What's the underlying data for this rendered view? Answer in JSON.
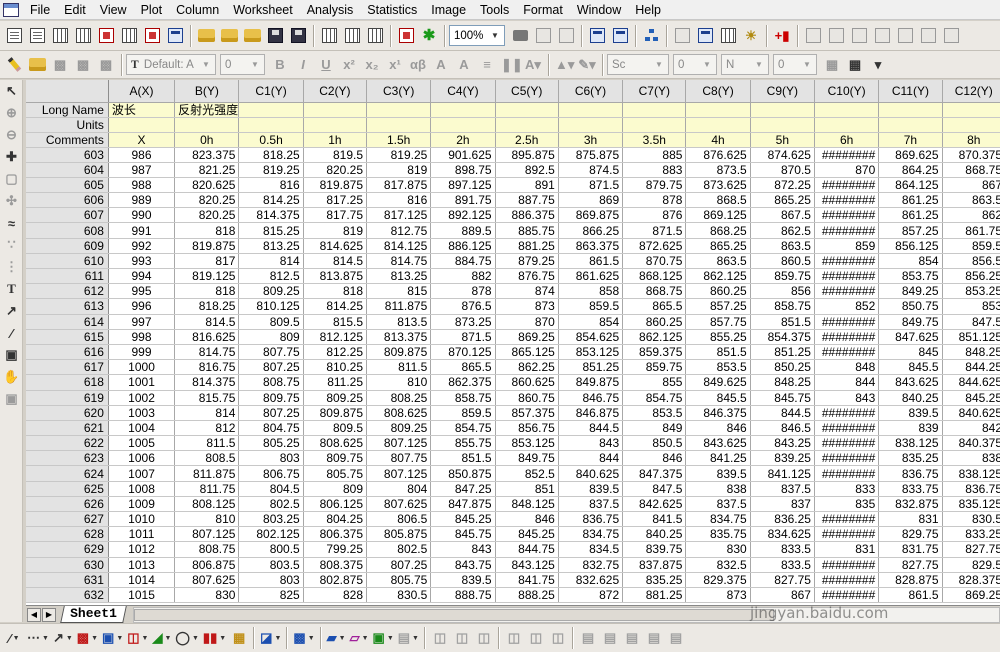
{
  "menubar": {
    "items": [
      "File",
      "Edit",
      "View",
      "Plot",
      "Column",
      "Worksheet",
      "Analysis",
      "Statistics",
      "Image",
      "Tools",
      "Format",
      "Window",
      "Help"
    ]
  },
  "toolbar1": {
    "zoom_value": "100%"
  },
  "toolbar2": {
    "font_name": "Default: A",
    "font_size": "0",
    "line_style": "Sc",
    "line_width": "0",
    "fill_color": "N",
    "fill_value": "0"
  },
  "worksheet": {
    "sheet_tab_label": "Sheet1",
    "column_headers": [
      "A(X)",
      "B(Y)",
      "C1(Y)",
      "C2(Y)",
      "C3(Y)",
      "C4(Y)",
      "C5(Y)",
      "C6(Y)",
      "C7(Y)",
      "C8(Y)",
      "C9(Y)",
      "C10(Y)",
      "C11(Y)",
      "C12(Y)"
    ],
    "meta_rows": [
      {
        "label": "Long Name",
        "values": [
          "波长",
          "反射光强度",
          "",
          "",
          "",
          "",
          "",
          "",
          "",
          "",
          "",
          "",
          "",
          ""
        ]
      },
      {
        "label": "Units",
        "values": [
          "",
          "",
          "",
          "",
          "",
          "",
          "",
          "",
          "",
          "",
          "",
          "",
          "",
          ""
        ]
      },
      {
        "label": "Comments",
        "values": [
          "X",
          "0h",
          "0.5h",
          "1h",
          "1.5h",
          "2h",
          "2.5h",
          "3h",
          "3.5h",
          "4h",
          "5h",
          "6h",
          "7h",
          "8h"
        ]
      }
    ],
    "rows": [
      {
        "n": "603",
        "cells": [
          "986",
          "823.375",
          "818.25",
          "819.5",
          "819.25",
          "901.625",
          "895.875",
          "875.875",
          "885",
          "876.625",
          "874.625",
          "########",
          "869.625",
          "870.375"
        ]
      },
      {
        "n": "604",
        "cells": [
          "987",
          "821.25",
          "819.25",
          "820.25",
          "819",
          "898.75",
          "892.5",
          "874.5",
          "883",
          "873.5",
          "870.5",
          "870",
          "864.25",
          "868.75"
        ]
      },
      {
        "n": "605",
        "cells": [
          "988",
          "820.625",
          "816",
          "819.875",
          "817.875",
          "897.125",
          "891",
          "871.5",
          "879.75",
          "873.625",
          "872.25",
          "########",
          "864.125",
          "867"
        ]
      },
      {
        "n": "606",
        "cells": [
          "989",
          "820.25",
          "814.25",
          "817.25",
          "816",
          "891.75",
          "887.75",
          "869",
          "878",
          "868.5",
          "865.25",
          "########",
          "861.25",
          "863.5"
        ]
      },
      {
        "n": "607",
        "cells": [
          "990",
          "820.25",
          "814.375",
          "817.75",
          "817.125",
          "892.125",
          "886.375",
          "869.875",
          "876",
          "869.125",
          "867.5",
          "########",
          "861.25",
          "862"
        ]
      },
      {
        "n": "608",
        "cells": [
          "991",
          "818",
          "815.25",
          "819",
          "812.75",
          "889.5",
          "885.75",
          "866.25",
          "871.5",
          "868.25",
          "862.5",
          "########",
          "857.25",
          "861.75"
        ]
      },
      {
        "n": "609",
        "cells": [
          "992",
          "819.875",
          "813.25",
          "814.625",
          "814.125",
          "886.125",
          "881.25",
          "863.375",
          "872.625",
          "865.25",
          "863.5",
          "859",
          "856.125",
          "859.5"
        ]
      },
      {
        "n": "610",
        "cells": [
          "993",
          "817",
          "814",
          "814.5",
          "814.75",
          "884.75",
          "879.25",
          "861.5",
          "870.75",
          "863.5",
          "860.5",
          "########",
          "854",
          "856.5"
        ]
      },
      {
        "n": "611",
        "cells": [
          "994",
          "819.125",
          "812.5",
          "813.875",
          "813.25",
          "882",
          "876.75",
          "861.625",
          "868.125",
          "862.125",
          "859.75",
          "########",
          "853.75",
          "856.25"
        ]
      },
      {
        "n": "612",
        "cells": [
          "995",
          "818",
          "809.25",
          "818",
          "815",
          "878",
          "874",
          "858",
          "868.75",
          "860.25",
          "856",
          "########",
          "849.25",
          "853.25"
        ]
      },
      {
        "n": "613",
        "cells": [
          "996",
          "818.25",
          "810.125",
          "814.25",
          "811.875",
          "876.5",
          "873",
          "859.5",
          "865.5",
          "857.25",
          "858.75",
          "852",
          "850.75",
          "853"
        ]
      },
      {
        "n": "614",
        "cells": [
          "997",
          "814.5",
          "809.5",
          "815.5",
          "813.5",
          "873.25",
          "870",
          "854",
          "860.25",
          "857.75",
          "851.5",
          "########",
          "849.75",
          "847.5"
        ]
      },
      {
        "n": "615",
        "cells": [
          "998",
          "816.625",
          "809",
          "812.125",
          "813.375",
          "871.5",
          "869.25",
          "854.625",
          "862.125",
          "855.25",
          "854.375",
          "########",
          "847.625",
          "851.125"
        ]
      },
      {
        "n": "616",
        "cells": [
          "999",
          "814.75",
          "807.75",
          "812.25",
          "809.875",
          "870.125",
          "865.125",
          "853.125",
          "859.375",
          "851.5",
          "851.25",
          "########",
          "845",
          "848.25"
        ]
      },
      {
        "n": "617",
        "cells": [
          "1000",
          "816.75",
          "807.25",
          "810.25",
          "811.5",
          "865.5",
          "862.25",
          "851.25",
          "859.75",
          "853.5",
          "850.25",
          "848",
          "845.5",
          "844.25"
        ]
      },
      {
        "n": "618",
        "cells": [
          "1001",
          "814.375",
          "808.75",
          "811.25",
          "810",
          "862.375",
          "860.625",
          "849.875",
          "855",
          "849.625",
          "848.25",
          "844",
          "843.625",
          "844.625"
        ]
      },
      {
        "n": "619",
        "cells": [
          "1002",
          "815.75",
          "809.75",
          "809.25",
          "808.25",
          "858.75",
          "860.75",
          "846.75",
          "854.75",
          "845.5",
          "845.75",
          "843",
          "840.25",
          "845.25"
        ]
      },
      {
        "n": "620",
        "cells": [
          "1003",
          "814",
          "807.25",
          "809.875",
          "808.625",
          "859.5",
          "857.375",
          "846.875",
          "853.5",
          "846.375",
          "844.5",
          "########",
          "839.5",
          "840.625"
        ]
      },
      {
        "n": "621",
        "cells": [
          "1004",
          "812",
          "804.75",
          "809.5",
          "809.25",
          "854.75",
          "856.75",
          "844.5",
          "849",
          "846",
          "846.5",
          "########",
          "839",
          "842"
        ]
      },
      {
        "n": "622",
        "cells": [
          "1005",
          "811.5",
          "805.25",
          "808.625",
          "807.125",
          "855.75",
          "853.125",
          "843",
          "850.5",
          "843.625",
          "843.25",
          "########",
          "838.125",
          "840.375"
        ]
      },
      {
        "n": "623",
        "cells": [
          "1006",
          "808.5",
          "803",
          "809.75",
          "807.75",
          "851.5",
          "849.75",
          "844",
          "846",
          "841.25",
          "839.25",
          "########",
          "835.25",
          "838"
        ]
      },
      {
        "n": "624",
        "cells": [
          "1007",
          "811.875",
          "806.75",
          "805.75",
          "807.125",
          "850.875",
          "852.5",
          "840.625",
          "847.375",
          "839.5",
          "841.125",
          "########",
          "836.75",
          "838.125"
        ]
      },
      {
        "n": "625",
        "cells": [
          "1008",
          "811.75",
          "804.5",
          "809",
          "804",
          "847.25",
          "851",
          "839.5",
          "847.5",
          "838",
          "837.5",
          "833",
          "833.75",
          "836.75"
        ]
      },
      {
        "n": "626",
        "cells": [
          "1009",
          "808.125",
          "802.5",
          "806.125",
          "807.625",
          "847.875",
          "848.125",
          "837.5",
          "842.625",
          "837.5",
          "837",
          "835",
          "832.875",
          "835.125"
        ]
      },
      {
        "n": "627",
        "cells": [
          "1010",
          "810",
          "803.25",
          "804.25",
          "806.5",
          "845.25",
          "846",
          "836.75",
          "841.5",
          "834.75",
          "836.25",
          "########",
          "831",
          "830.5"
        ]
      },
      {
        "n": "628",
        "cells": [
          "1011",
          "807.125",
          "802.125",
          "806.375",
          "805.875",
          "845.75",
          "845.25",
          "834.75",
          "840.25",
          "835.75",
          "834.625",
          "########",
          "829.75",
          "833.25"
        ]
      },
      {
        "n": "629",
        "cells": [
          "1012",
          "808.75",
          "800.5",
          "799.25",
          "802.5",
          "843",
          "844.75",
          "834.5",
          "839.75",
          "830",
          "833.5",
          "831",
          "831.75",
          "827.75"
        ]
      },
      {
        "n": "630",
        "cells": [
          "1013",
          "806.875",
          "803.5",
          "808.375",
          "807.25",
          "843.75",
          "843.125",
          "832.75",
          "837.875",
          "832.5",
          "833.5",
          "########",
          "827.75",
          "829.5"
        ]
      },
      {
        "n": "631",
        "cells": [
          "1014",
          "807.625",
          "803",
          "802.875",
          "805.75",
          "839.5",
          "841.75",
          "832.625",
          "835.25",
          "829.375",
          "827.75",
          "########",
          "828.875",
          "828.375"
        ]
      },
      {
        "n": "632",
        "cells": [
          "1015",
          "830",
          "825",
          "828",
          "830.5",
          "888.75",
          "888.25",
          "872",
          "881.25",
          "873",
          "867",
          "########",
          "861.5",
          "869.25"
        ]
      }
    ]
  },
  "watermark": {
    "text": "jingyan.baidu.com"
  }
}
